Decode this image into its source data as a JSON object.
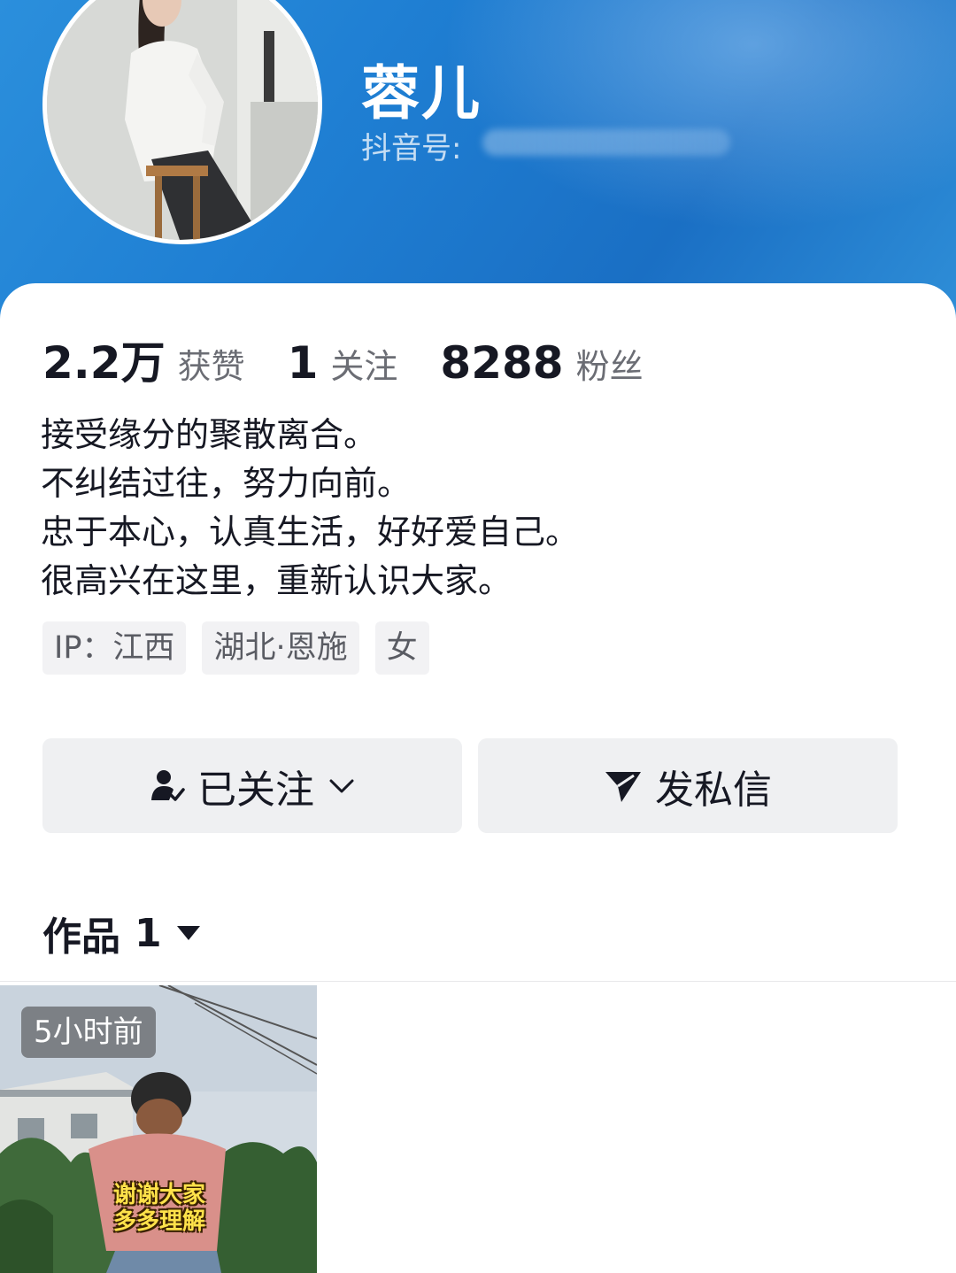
{
  "profile": {
    "username": "蓉儿",
    "douyin_id_label": "抖音号:"
  },
  "stats": [
    {
      "value": "2.2万",
      "label": "获赞"
    },
    {
      "value": "1",
      "label": "关注"
    },
    {
      "value": "8288",
      "label": "粉丝"
    }
  ],
  "bio": [
    "接受缘分的聚散离合。",
    "不纠结过往，努力向前。",
    "忠于本心，认真生活，好好爱自己。",
    "很高兴在这里，重新认识大家。"
  ],
  "tags": [
    "IP：江西",
    "湖北·恩施",
    "女"
  ],
  "actions": {
    "follow_label": "已关注",
    "message_label": "发私信"
  },
  "works": {
    "label": "作品",
    "count": "1"
  },
  "videos": [
    {
      "time": "5小时前",
      "caption_line1": "谢谢大家",
      "caption_line2": "多多理解"
    }
  ],
  "icons": {
    "follow": "person-check-icon",
    "follow_menu": "chevron-down-icon",
    "message": "send-icon",
    "works_sort": "caret-down-icon"
  },
  "colors": {
    "header": "#1f7fd3",
    "text_primary": "#161823",
    "text_secondary": "#6b6d74",
    "button_bg": "#eff0f2"
  }
}
